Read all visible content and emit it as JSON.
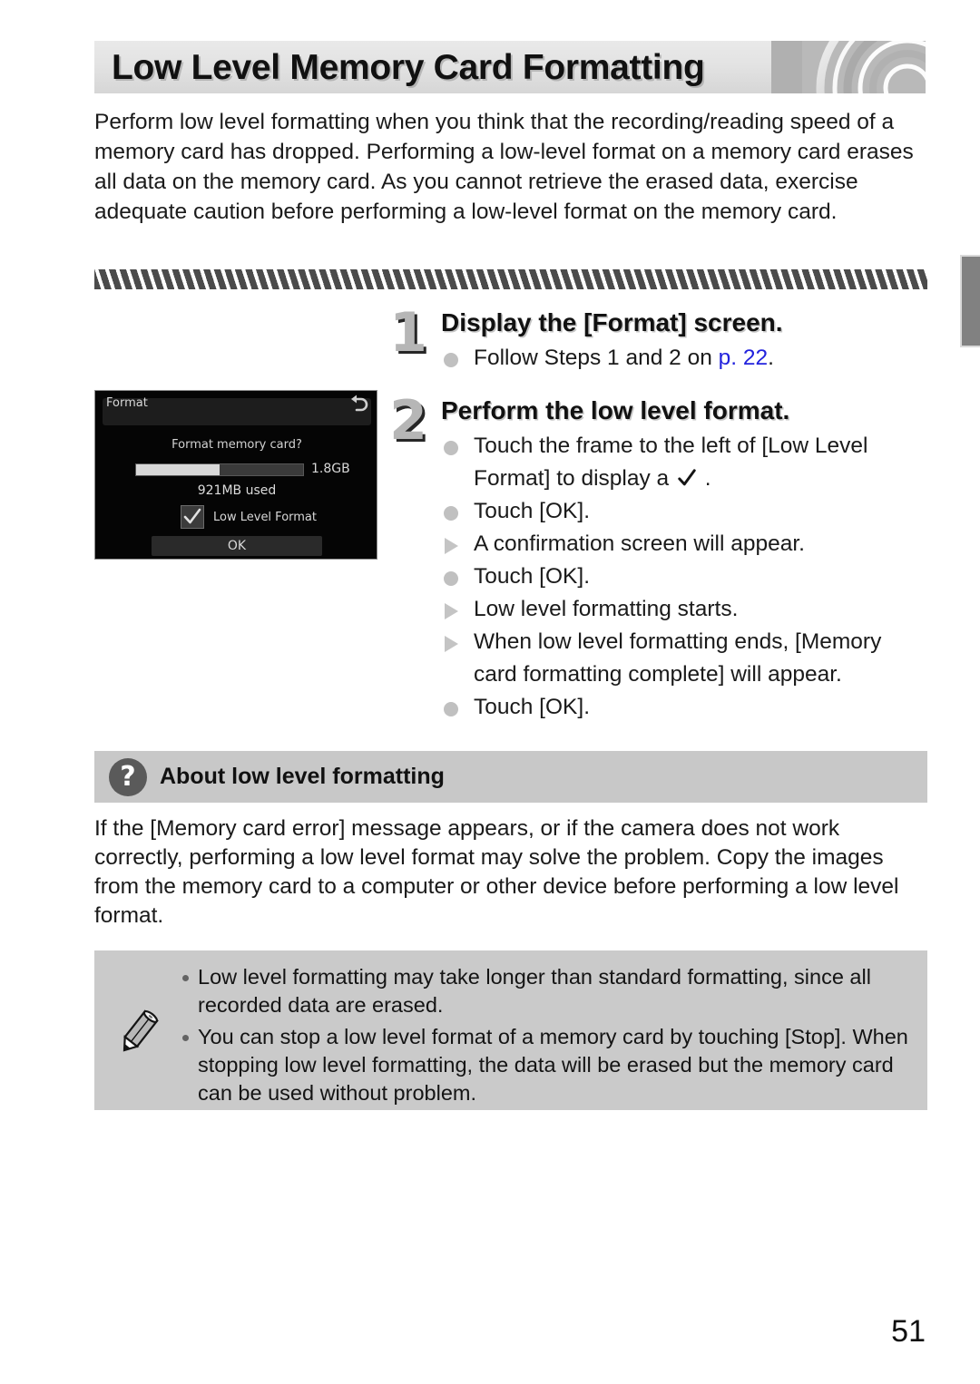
{
  "page": {
    "title": "Low Level Memory Card Formatting",
    "number": "51"
  },
  "intro": "Perform low level formatting when you think that the recording/reading speed of a memory card has dropped. Performing a low-level format on a memory card erases all data on the memory card. As you cannot retrieve the erased data, exercise adequate caution before performing a low-level format on the memory card.",
  "steps": [
    {
      "number": "1",
      "heading": "Display the [Format] screen.",
      "items": [
        {
          "bullet": "circle",
          "text_before": "Follow Steps 1 and 2 on ",
          "link": "p. 22",
          "text_after": "."
        }
      ]
    },
    {
      "number": "2",
      "heading": "Perform the low level format.",
      "items": [
        {
          "bullet": "circle",
          "text_before": "Touch the frame to the left of [Low Level Format] to display a ",
          "icon": "checkmark-icon",
          "text_after": " ."
        },
        {
          "bullet": "circle",
          "text_before": "Touch [OK]."
        },
        {
          "bullet": "triangle",
          "text_before": "A confirmation screen will appear."
        },
        {
          "bullet": "circle",
          "text_before": "Touch [OK]."
        },
        {
          "bullet": "triangle",
          "text_before": "Low level formatting starts."
        },
        {
          "bullet": "triangle",
          "text_before": "When low level formatting ends, [Memory card formatting complete] will appear."
        },
        {
          "bullet": "circle",
          "text_before": "Touch [OK]."
        }
      ]
    }
  ],
  "camera_screen": {
    "title": "Format",
    "back_icon": "return-arrow-icon",
    "question": "Format memory card?",
    "capacity": "1.8GB",
    "used": "921MB used",
    "progress_percent": 50,
    "checkbox_checked": true,
    "checkbox_label": "Low Level Format",
    "ok_button": "OK"
  },
  "about": {
    "icon": "question-mark-icon",
    "title": "About low level formatting",
    "body": "If the [Memory card error] message appears, or if the camera does not work correctly, performing a low level format may solve the problem. Copy the images from the memory card to a computer or other device before performing a low level format."
  },
  "notes": {
    "icon": "pencil-icon",
    "items": [
      "Low level formatting may take longer than standard formatting, since all recorded data are erased.",
      "You can stop a low level format of a memory card by touching [Stop]. When stopping low level formatting, the data will be erased but the memory card can be used without problem."
    ]
  },
  "colors": {
    "link": "#2222dd",
    "header_bg": "#e4e4e4",
    "panel_gray": "#c8c8c8",
    "note_gray": "#cacaca",
    "edge_tab": "#818181"
  }
}
